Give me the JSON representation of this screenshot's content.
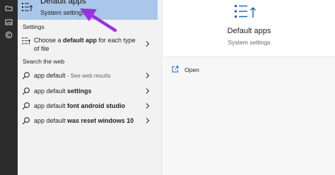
{
  "best_match": {
    "title": "Default apps",
    "subtitle": "System settings"
  },
  "settings_section": {
    "header": "Settings",
    "items": [
      {
        "prefix": "Choose a ",
        "bold": "default app",
        "suffix": " for each type",
        "line2": "of file"
      }
    ]
  },
  "web_section": {
    "header": "Search the web",
    "items": [
      {
        "prefix": "app default",
        "bold": "",
        "suffix": " - See web results"
      },
      {
        "prefix": "app default ",
        "bold": "settings",
        "suffix": ""
      },
      {
        "prefix": "app default ",
        "bold": "font android studio",
        "suffix": ""
      },
      {
        "prefix": "app default ",
        "bold": "was reset windows 10",
        "suffix": ""
      }
    ]
  },
  "preview": {
    "title": "Default apps",
    "subtitle": "System settings",
    "actions": [
      {
        "label": "Open"
      }
    ]
  },
  "colors": {
    "selected_bg": "#a9c7e8",
    "accent": "#0a63c9",
    "annotation_arrow": "#9b30e6"
  },
  "icons": {
    "best_match": "default-apps-icon",
    "settings_item": "settings-list-icon",
    "web_search": "search-icon",
    "open": "open-external-icon"
  }
}
